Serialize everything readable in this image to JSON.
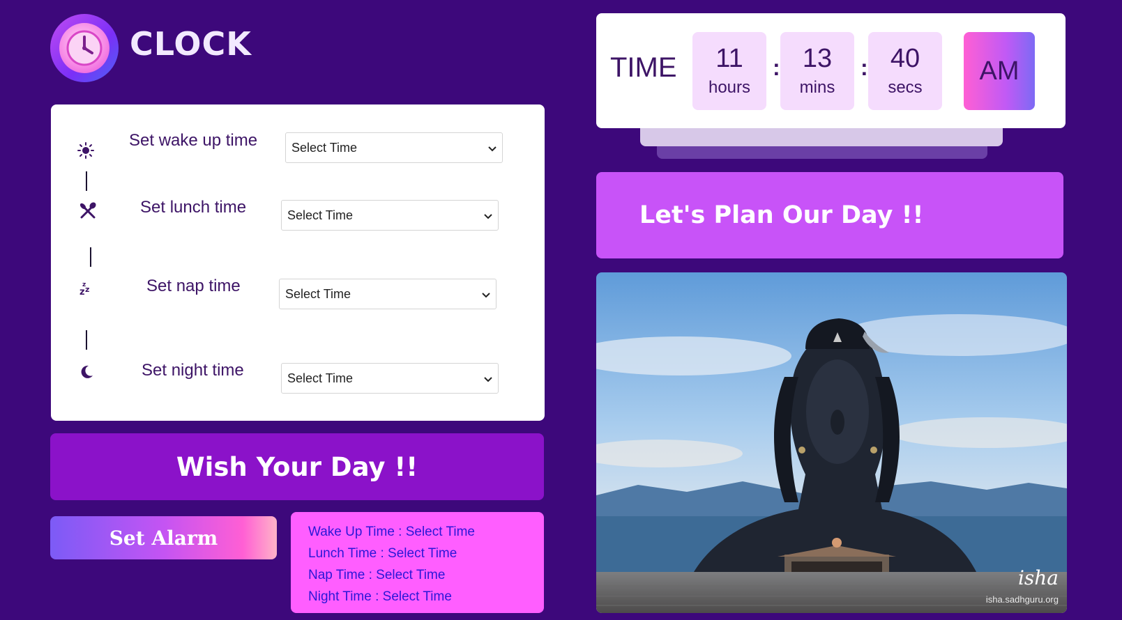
{
  "logo": {
    "icon": "clock-icon",
    "title": "CLOCK"
  },
  "schedule": {
    "rows": [
      {
        "icon": "sun-icon",
        "label": "Set wake up time",
        "selected": "Select Time"
      },
      {
        "icon": "fork-knife-icon",
        "label": "Set lunch time",
        "selected": "Select Time"
      },
      {
        "icon": "zzz-icon",
        "label": "Set nap time",
        "selected": "Select Time"
      },
      {
        "icon": "moon-icon",
        "label": "Set night time",
        "selected": "Select Time"
      }
    ]
  },
  "wish": {
    "text": "Wish Your Day !!"
  },
  "alarm": {
    "label": "Set Alarm"
  },
  "summary": {
    "lines": [
      "Wake Up Time : Select Time",
      "Lunch Time : Select Time",
      "Nap Time : Select Time",
      "Night Time : Select Time"
    ]
  },
  "clock": {
    "label": "TIME",
    "hours": "11",
    "hours_label": "hours",
    "mins": "13",
    "mins_label": "mins",
    "secs": "40",
    "secs_label": "secs",
    "separator": ":",
    "ampm": "AM"
  },
  "plan": {
    "text": "Let's Plan Our Day !!"
  },
  "photo": {
    "watermark_logo": "isha",
    "watermark_url": "isha.sadhguru.org"
  },
  "colors": {
    "background": "#3d087b",
    "accent_purple": "#8b12c9",
    "accent_violet": "#c853f8",
    "accent_pink": "#ff5eff",
    "text_dark": "#3d1466"
  }
}
